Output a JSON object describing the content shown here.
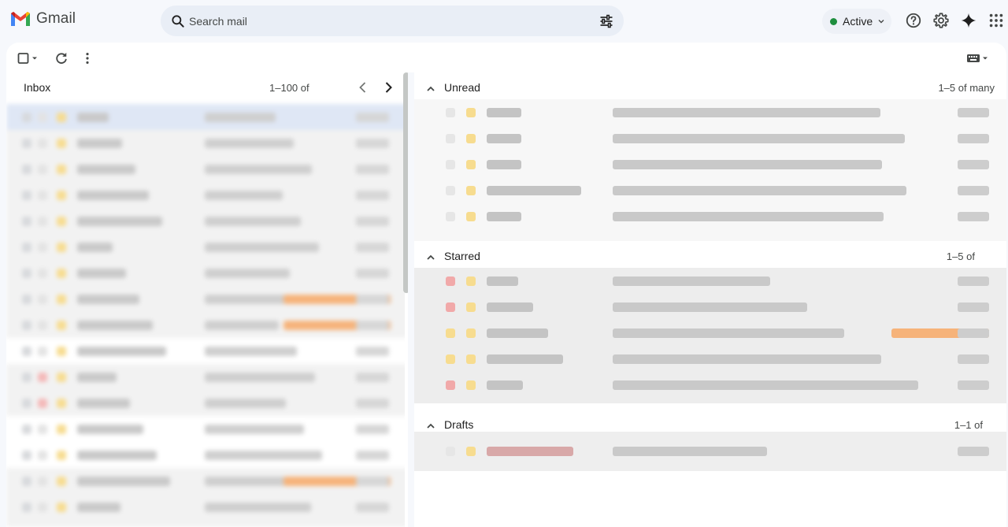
{
  "app": {
    "name": "Gmail"
  },
  "search": {
    "placeholder": "Search mail"
  },
  "status": {
    "label": "Active",
    "color": "#1e8e3e"
  },
  "icons": {
    "search": "search-icon",
    "tune": "tune-icon",
    "help": "help-icon",
    "settings": "gear-icon",
    "gemini": "sparkle-icon",
    "apps": "apps-grid-icon",
    "select": "checkbox-icon",
    "refresh": "refresh-icon",
    "more": "more-vert-icon",
    "input_tools": "keyboard-icon"
  },
  "inbox": {
    "title": "Inbox",
    "count_text": "1–100 of"
  },
  "sections": [
    {
      "title": "Unread",
      "count_text": "1–5 of many"
    },
    {
      "title": "Starred",
      "count_text": "1–5 of"
    },
    {
      "title": "Drafts",
      "count_text": "1–1 of"
    }
  ],
  "colors": {
    "accent_blue": "#0b57d0",
    "background": "#f6f8fc",
    "search_bg": "#e9eef6"
  }
}
